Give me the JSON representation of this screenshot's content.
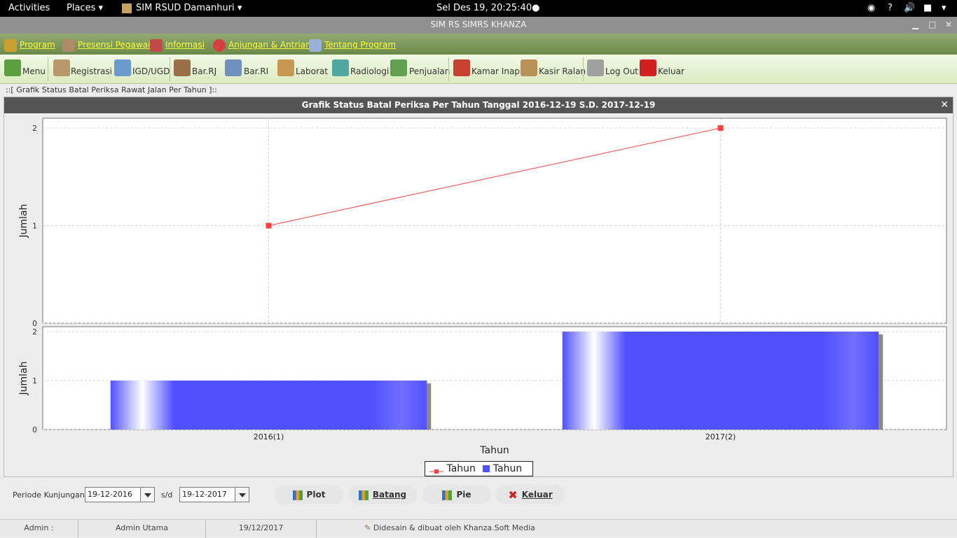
{
  "system_bar": {
    "activities": "Activities",
    "places": "Places",
    "app_name": "SIM RSUD Damanhuri",
    "clock": "Sel Des 19, 20:25:40"
  },
  "window": {
    "title": "SIM RS SIMRS KHANZA"
  },
  "menu": [
    {
      "label": "Program",
      "icon": "key-icon",
      "color": "#caa030"
    },
    {
      "label": "Presensi Pegawai",
      "icon": "employee-icon",
      "color": "#b08a68"
    },
    {
      "label": "Informasi",
      "icon": "books-icon",
      "color": "#c04848"
    },
    {
      "label": "Anjungan & Antrian",
      "icon": "lifebuoy-icon",
      "color": "#d64040"
    },
    {
      "label": "Tentang Program",
      "icon": "notepad-icon",
      "color": "#9ab0d8"
    }
  ],
  "toolbar": [
    {
      "label": "Menu",
      "icon": "home-icon",
      "color": "#5aa040"
    },
    {
      "label": "Registrasi",
      "icon": "register-icon",
      "color": "#b8986a"
    },
    {
      "label": "IGD/UGD",
      "icon": "doctor-icon",
      "color": "#6a9ad0"
    },
    {
      "label": "Bar.RJ",
      "icon": "outpatient-icon",
      "color": "#9a7048"
    },
    {
      "label": "Bar.RI",
      "icon": "inpatient-icon",
      "color": "#7090c0"
    },
    {
      "label": "Laborat",
      "icon": "laboratory-icon",
      "color": "#c89850"
    },
    {
      "label": "Radiologi",
      "icon": "radiology-icon",
      "color": "#50a8a0"
    },
    {
      "label": "Penjualan",
      "icon": "cart-icon",
      "color": "#60a050"
    },
    {
      "label": "Kamar Inap",
      "icon": "house-icon",
      "color": "#c84030"
    },
    {
      "label": "Kasir Ralan",
      "icon": "cashier-icon",
      "color": "#b89058"
    },
    {
      "label": "Log Out",
      "icon": "keys-icon",
      "color": "#a0a0a0"
    },
    {
      "label": "Keluar",
      "icon": "exit-icon",
      "color": "#d02020"
    }
  ],
  "tab_title": "::[ Grafik Status Batal Periksa Rawat Jalan Per Tahun ]::",
  "chart_window": {
    "title": "Grafik Status Batal Periksa Per Tahun Tanggal 2016-12-19 S.D. 2017-12-19"
  },
  "chart_data": [
    {
      "type": "line",
      "categories": [
        "2016(1)",
        "2017(2)"
      ],
      "series": [
        {
          "name": "Tahun",
          "values": [
            1,
            2
          ],
          "color": "#ff4040"
        }
      ],
      "ylabel": "Jumlah",
      "ylim": [
        0,
        2
      ],
      "yticks": [
        "0",
        "1",
        "2"
      ],
      "grid": true
    },
    {
      "type": "bar",
      "categories": [
        "2016(1)",
        "2017(2)"
      ],
      "series": [
        {
          "name": "Tahun",
          "values": [
            1,
            2
          ],
          "color": "#5050ff"
        }
      ],
      "xlabel": "Tahun",
      "ylabel": "Jumlah",
      "ylim": [
        0,
        2
      ],
      "yticks": [
        "0",
        "1",
        "2"
      ],
      "grid": true
    }
  ],
  "legend": {
    "placement": "bottom-center",
    "items": [
      {
        "label": "Tahun",
        "color": "#ff4040"
      },
      {
        "label": "Tahun",
        "color": "#5050ff"
      }
    ]
  },
  "filter": {
    "period_label": "Periode Kunjungan :",
    "date_from": "19-12-2016",
    "separator": "s/d",
    "date_to": "19-12-2017"
  },
  "buttons": {
    "plot": "Plot",
    "batang": "Batang",
    "pie": "Pie",
    "keluar": "Keluar"
  },
  "statusbar": {
    "user_label": "Admin :",
    "user_name": "Admin Utama",
    "date": "19/12/2017",
    "credit": "Didesain & dibuat oleh Khanza.Soft Media"
  }
}
